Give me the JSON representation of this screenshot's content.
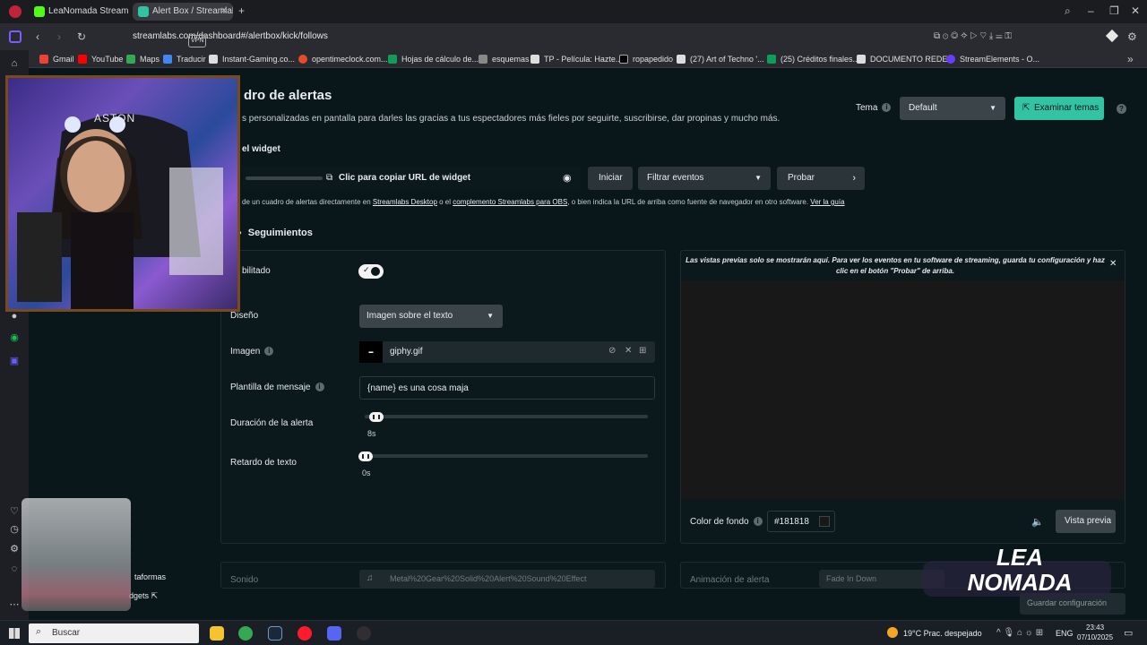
{
  "browser": {
    "tabs": [
      {
        "title": "LeaNomada Stream - Wa",
        "active": false
      },
      {
        "title": "Alert Box / Streamlabs",
        "active": true
      }
    ],
    "url": "streamlabs.com/dashboard#/alertbox/kick/follows",
    "vpn_label": "VPN",
    "bookmarks": [
      "Gmail",
      "YouTube",
      "Maps",
      "Traducir",
      "Instant-Gaming.co...",
      "opentimeclock.com...",
      "Hojas de cálculo de...",
      "esquemas",
      "TP - Película: Hazte...",
      "ropapedido",
      "(27) Art of Techno '...",
      "(25) Créditos finales...",
      "DOCUMENTO REDE...",
      "StreamElements - O..."
    ]
  },
  "page": {
    "title_partial": "dro de alertas",
    "subtitle_partial": "s personalizadas en pantalla para darles las gracias a tus espectadores más fieles por seguirte, suscribirse, dar propinas y mucho más.",
    "theme_label": "Tema",
    "theme_value": "Default",
    "explore_themes": "Examinar temas",
    "widget_label_partial": "el widget",
    "copy_url": "Clic para copiar URL de widget",
    "start_button": "Iniciar",
    "filter_events": "Filtrar eventos",
    "test_button": "Probar",
    "help_line_a": "de un cuadro de alertas directamente en ",
    "help_link_a": "Streamlabs Desktop",
    "help_line_b": " o el ",
    "help_link_b": "complemento Streamlabs para OBS",
    "help_line_c": ", o bien indica la URL de arriba como fuente de navegador en otro software. ",
    "help_link_c": "Ver la guía",
    "section_title": "Seguimientos"
  },
  "settings": {
    "enabled_label_partial": "bilitado",
    "enabled": true,
    "layout_label": "Diseño",
    "layout_value": "Imagen sobre el texto",
    "image_label": "Imagen",
    "image_value": "giphy.gif",
    "template_label": "Plantilla de mensaje",
    "template_value": "{name} es una cosa maja",
    "duration_label": "Duración de la alerta",
    "duration_value": "8s",
    "duration_fraction": 0.02,
    "text_delay_label": "Retardo de texto",
    "text_delay_value": "0s",
    "text_delay_fraction": 0.0,
    "sound_label": "Sonido",
    "sound_value": "Metal%20Gear%20Solid%20Alert%20Sound%20Effect",
    "animation_label": "Animación de alerta",
    "animation_value": "Fade In Down"
  },
  "preview": {
    "notice": "Las vistas previas solo se mostrarán aquí. Para ver los eventos en tu software de streaming, guarda tu configuración y haz clic en el botón \"Probar\" de arriba.",
    "bg_color_label": "Color de fondo",
    "bg_color_value": "#181818",
    "preview_button": "Vista previa",
    "save_button_partial": "Guardar configuración"
  },
  "sidebar_bottom": {
    "item1_partial": "taformas",
    "item2_partial": "dgets"
  },
  "overlay": {
    "logo_text": "LEA NOMADA"
  },
  "taskbar": {
    "search_placeholder": "Buscar",
    "weather": "19°C  Prac. despejado",
    "lang": "ENG",
    "time": "23:43",
    "date": "07/10/2025"
  },
  "colors": {
    "accent_green": "#31c3a2",
    "page_bg": "#09161a"
  }
}
